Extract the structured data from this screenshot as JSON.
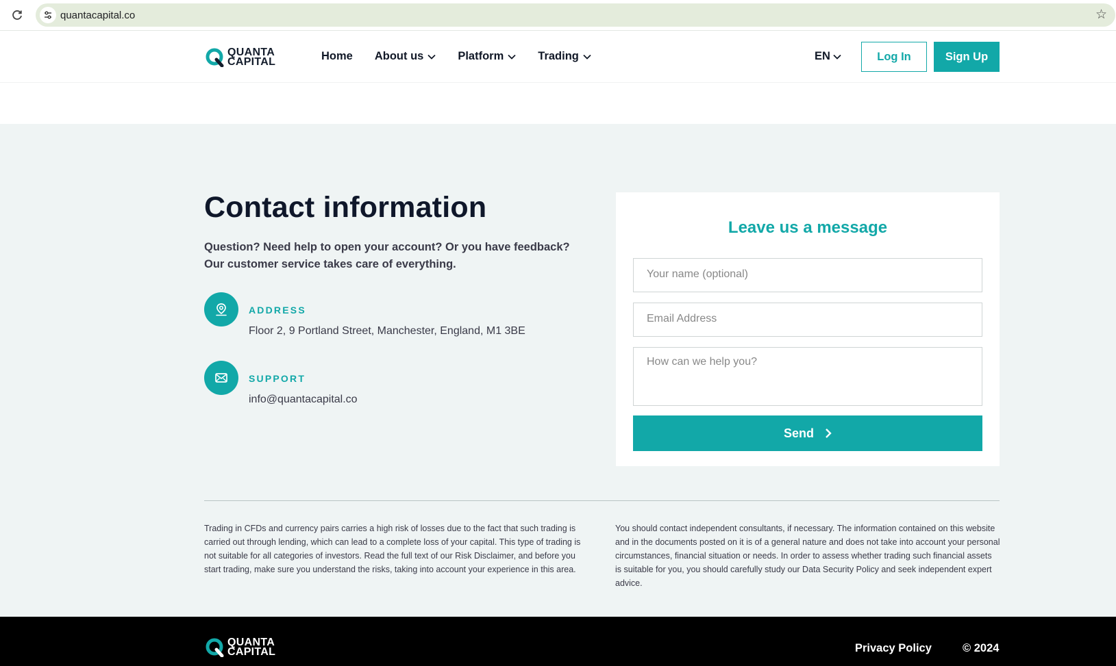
{
  "browser": {
    "url": "quantacapital.co",
    "icons": [
      "reload-icon",
      "site-info-icon",
      "bookmark-star-icon"
    ]
  },
  "header": {
    "logo": {
      "line1": "QUANTA",
      "line2": "CAPITAL"
    },
    "nav": [
      {
        "label": "Home",
        "has_dropdown": false
      },
      {
        "label": "About us",
        "has_dropdown": true
      },
      {
        "label": "Platform",
        "has_dropdown": true
      },
      {
        "label": "Trading",
        "has_dropdown": true
      }
    ],
    "language": "EN",
    "login_label": "Log In",
    "signup_label": "Sign Up"
  },
  "contact": {
    "title": "Contact information",
    "intro": "Question? Need help to open your account? Or you have feedback? Our customer service takes care of everything.",
    "address": {
      "label": "ADDRESS",
      "value": "Floor 2, 9 Portland Street, Manchester, England, M1 3BE",
      "icon": "location-pin-icon"
    },
    "support": {
      "label": "SUPPORT",
      "value": "info@quantacapital.co",
      "icon": "envelope-icon"
    }
  },
  "form": {
    "title": "Leave us a message",
    "name_placeholder": "Your name (optional)",
    "email_placeholder": "Email Address",
    "message_placeholder": "How can we help you?",
    "send_label": "Send"
  },
  "disclaimer": {
    "left": "Trading in CFDs and currency pairs carries a high risk of losses due to the fact that such trading is carried out through lending, which can lead to a complete loss of your capital. This type of trading is not suitable for all categories of investors. Read the full text of our Risk Disclaimer, and before you start trading, make sure you understand the risks, taking into account your experience in this area.",
    "right": "You should contact independent consultants, if necessary. The information contained on this website and in the documents posted on it is of a general nature and does not take into account your personal circumstances, financial situation or needs. In order to assess whether trading such financial assets is suitable for you, you should carefully study our Data Security Policy and seek independent expert advice."
  },
  "footer": {
    "logo": {
      "line1": "QUANTA",
      "line2": "CAPITAL"
    },
    "privacy_label": "Privacy Policy",
    "copyright": "© 2024"
  },
  "colors": {
    "accent": "#12a8a8",
    "band": "#eff4f4",
    "footer": "#000000"
  }
}
